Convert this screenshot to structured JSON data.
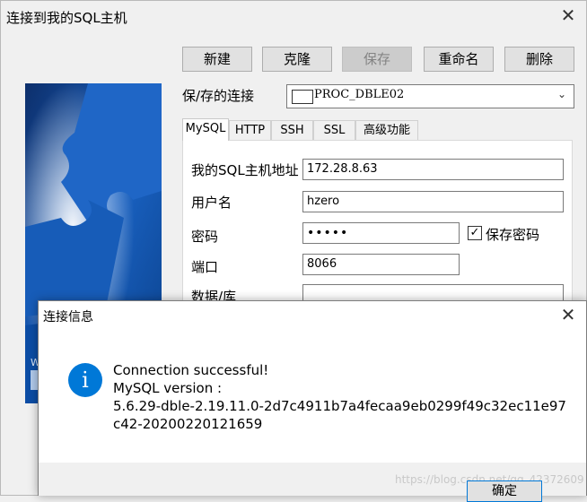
{
  "window": {
    "title": "连接到我的SQL主机"
  },
  "toolbar": {
    "new_label": "新建",
    "clone_label": "克隆",
    "save_label": "保存",
    "rename_label": "重命名",
    "delete_label": "删除"
  },
  "connection": {
    "label": "保/存的连接",
    "selected": "PROC_DBLE02"
  },
  "tabs": [
    {
      "label": "MySQL",
      "active": true
    },
    {
      "label": "HTTP"
    },
    {
      "label": "SSH"
    },
    {
      "label": "SSL"
    },
    {
      "label": "高级功能"
    }
  ],
  "form": {
    "host_label": "我的SQL主机地址",
    "host_value": "172.28.8.63",
    "user_label": "用户名",
    "user_value": "hzero",
    "password_label": "密码",
    "password_value": "•••••",
    "save_password_label": "保存密码",
    "save_password_checked": "✓",
    "port_label": "端口",
    "port_value": "8066",
    "database_label": "数据/库",
    "database_value": ""
  },
  "dialog": {
    "title": "连接信息",
    "icon_glyph": "i",
    "lines": [
      "Connection successful!",
      "MySQL version :",
      "5.6.29-dble-2.19.11.0-2d7c4911b7a4fecaa9eb0299f49c32ec11e97",
      "c42-20200220121659"
    ],
    "ok_label": "确定",
    "watermark": "https://blog.csdn.net/qq_42372609"
  },
  "colors": {
    "accent": "#0078d7",
    "side_image_blue": "#0b4a9a"
  }
}
